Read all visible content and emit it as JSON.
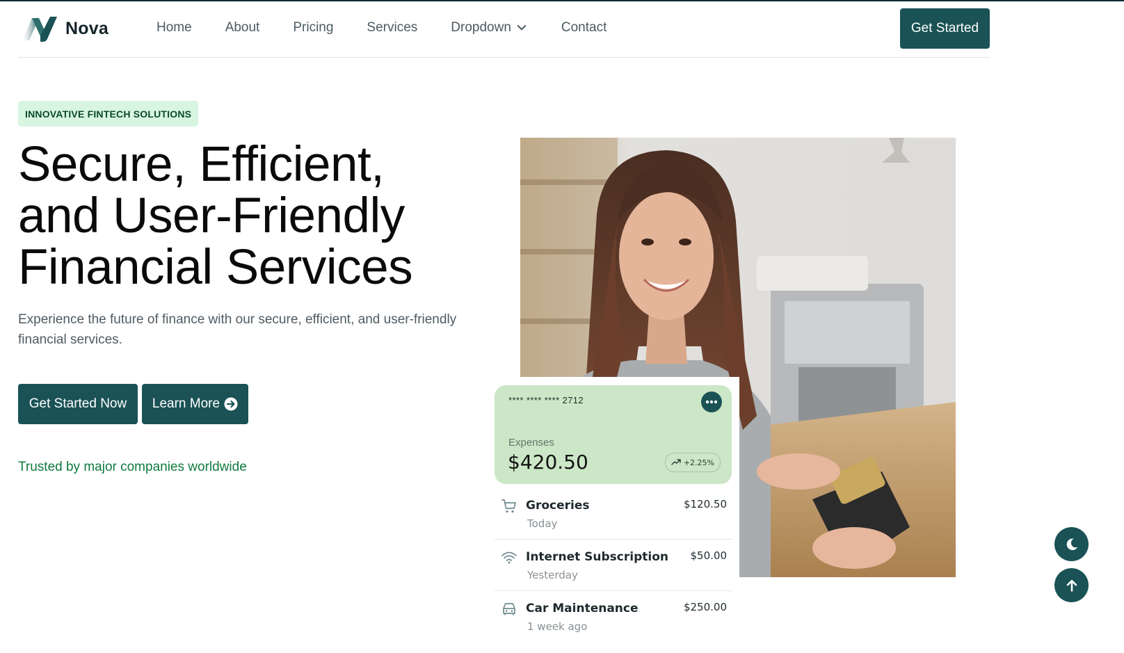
{
  "brand": {
    "name": "Nova",
    "accent": "#1a5256"
  },
  "nav": {
    "items": [
      {
        "label": "Home"
      },
      {
        "label": "About"
      },
      {
        "label": "Pricing"
      },
      {
        "label": "Services"
      },
      {
        "label": "Dropdown",
        "icon": "chevron-down-icon"
      },
      {
        "label": "Contact"
      }
    ],
    "cta_label": "Get Started"
  },
  "hero": {
    "badge": "INNOVATIVE FINTECH SOLUTIONS",
    "title_lines": [
      "Secure, Efficient,",
      "and User-Friendly",
      "Financial Services"
    ],
    "subtitle": "Experience the future of finance with our secure, efficient, and user-friendly financial services.",
    "primary_button": "Get Started Now",
    "secondary_button": "Learn More",
    "secondary_icon": "arrow-right-circle-icon",
    "trusted": "Trusted by major companies worldwide"
  },
  "card": {
    "number": "**** **** ****  2712",
    "menu_icon": "more-horizontal-icon",
    "label": "Expenses",
    "amount": "$420.50",
    "change": "+2.25%",
    "change_icon": "trending-up-icon",
    "background": "#cce7c7"
  },
  "transactions": [
    {
      "icon": "cart-icon",
      "name": "Groceries",
      "time": "Today",
      "amount": "$120.50"
    },
    {
      "icon": "wifi-icon",
      "name": "Internet Subscription",
      "time": "Yesterday",
      "amount": "$50.00"
    },
    {
      "icon": "car-icon",
      "name": "Car Maintenance",
      "time": "1 week ago",
      "amount": "$250.00"
    }
  ],
  "floating": {
    "theme_icon": "moon-icon",
    "scroll_icon": "arrow-up-icon"
  }
}
